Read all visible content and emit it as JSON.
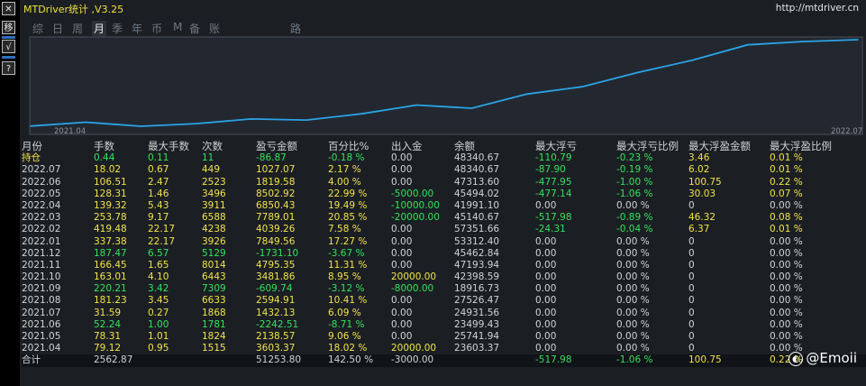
{
  "window": {
    "title": "MTDriver统计 ,V3.25",
    "url": "http://mtdriver.cn"
  },
  "left_tools": [
    "✕",
    "移",
    "√",
    "?"
  ],
  "period_tabs": [
    {
      "label": "综",
      "active": false
    },
    {
      "label": "日",
      "active": false
    },
    {
      "label": "周",
      "active": false
    },
    {
      "label": "月",
      "active": true
    },
    {
      "label": "季",
      "active": false
    },
    {
      "label": "年",
      "active": false
    },
    {
      "label": "币",
      "active": false
    },
    {
      "label": "M",
      "active": false
    },
    {
      "label": "备",
      "active": false
    },
    {
      "label": "账户",
      "active": false
    },
    {
      "label": "路径",
      "active": false
    }
  ],
  "chart_data": {
    "type": "line",
    "x_start_label": "2021.04",
    "x_end_label": "2022.07",
    "series": [
      {
        "color": "#2ba3e6",
        "x": [
          "2021.04",
          "2021.05",
          "2021.06",
          "2021.07",
          "2021.08",
          "2021.09",
          "2021.10",
          "2021.11",
          "2021.12",
          "2022.01",
          "2022.02",
          "2022.03",
          "2022.04",
          "2022.05",
          "2022.06",
          "2022.07"
        ],
        "values": [
          23603.37,
          25741.94,
          23499.43,
          24931.56,
          27526.47,
          26916.73,
          30398.59,
          35193.94,
          33462.84,
          41312.4,
          45351.66,
          53140.67,
          59991.1,
          68494.02,
          70313.6,
          71340.67
        ]
      }
    ]
  },
  "table": {
    "headers": [
      "月份",
      "手数",
      "最大手数",
      "次数",
      "盈亏金额",
      "百分比%",
      "出入金",
      "余额",
      "最大浮亏",
      "最大浮亏比例",
      "最大浮盈金额",
      "最大浮盈比例"
    ],
    "rows": [
      {
        "cells": [
          "持仓",
          "0.44",
          "0.11",
          "11",
          "-86.87",
          "-0.18 %",
          "0.00",
          "48340.67",
          "-110.79",
          "-0.23 %",
          "3.46",
          "0.01 %"
        ],
        "colors": [
          "y",
          "g",
          "g",
          "g",
          "g",
          "g",
          "w",
          "w",
          "g",
          "g",
          "y",
          "y"
        ]
      },
      {
        "cells": [
          "2022.07",
          "18.02",
          "0.67",
          "449",
          "1027.07",
          "2.17 %",
          "0.00",
          "48340.67",
          "-87.90",
          "-0.19 %",
          "6.02",
          "0.01 %"
        ],
        "colors": [
          "w",
          "y",
          "y",
          "y",
          "y",
          "y",
          "w",
          "w",
          "g",
          "g",
          "y",
          "y"
        ]
      },
      {
        "cells": [
          "2022.06",
          "106.51",
          "2.47",
          "2523",
          "1819.58",
          "4.00 %",
          "0.00",
          "47313.60",
          "-477.95",
          "-1.00 %",
          "100.75",
          "0.22 %"
        ],
        "colors": [
          "w",
          "y",
          "y",
          "y",
          "y",
          "y",
          "w",
          "w",
          "g",
          "g",
          "y",
          "y"
        ]
      },
      {
        "cells": [
          "2022.05",
          "128.31",
          "1.46",
          "3496",
          "8502.92",
          "22.99 %",
          "-5000.00",
          "45494.02",
          "-477.14",
          "-1.06 %",
          "30.03",
          "0.07 %"
        ],
        "colors": [
          "w",
          "y",
          "y",
          "y",
          "y",
          "y",
          "g",
          "w",
          "g",
          "g",
          "y",
          "y"
        ]
      },
      {
        "cells": [
          "2022.04",
          "139.32",
          "5.43",
          "3911",
          "6850.43",
          "19.49 %",
          "-10000.00",
          "41991.10",
          "0.00",
          "0.00 %",
          "0",
          "0.00 %"
        ],
        "colors": [
          "w",
          "y",
          "y",
          "y",
          "y",
          "y",
          "g",
          "w",
          "w",
          "w",
          "w",
          "w"
        ]
      },
      {
        "cells": [
          "2022.03",
          "253.78",
          "9.17",
          "6588",
          "7789.01",
          "20.85 %",
          "-20000.00",
          "45140.67",
          "-517.98",
          "-0.89 %",
          "46.32",
          "0.08 %"
        ],
        "colors": [
          "w",
          "y",
          "y",
          "y",
          "y",
          "y",
          "g",
          "w",
          "g",
          "g",
          "y",
          "y"
        ]
      },
      {
        "cells": [
          "2022.02",
          "419.48",
          "22.17",
          "4238",
          "4039.26",
          "7.58 %",
          "0.00",
          "57351.66",
          "-24.31",
          "-0.04 %",
          "6.37",
          "0.01 %"
        ],
        "colors": [
          "w",
          "y",
          "y",
          "y",
          "y",
          "y",
          "w",
          "w",
          "g",
          "g",
          "y",
          "y"
        ]
      },
      {
        "cells": [
          "2022.01",
          "337.38",
          "22.17",
          "3926",
          "7849.56",
          "17.27 %",
          "0.00",
          "53312.40",
          "0.00",
          "0.00 %",
          "0",
          "0.00 %"
        ],
        "colors": [
          "w",
          "y",
          "y",
          "y",
          "y",
          "y",
          "w",
          "w",
          "w",
          "w",
          "w",
          "w"
        ]
      },
      {
        "cells": [
          "2021.12",
          "187.47",
          "6.57",
          "5129",
          "-1731.10",
          "-3.67 %",
          "0.00",
          "45462.84",
          "0.00",
          "0.00 %",
          "0",
          "0.00 %"
        ],
        "colors": [
          "w",
          "g",
          "g",
          "g",
          "g",
          "g",
          "w",
          "w",
          "w",
          "w",
          "w",
          "w"
        ]
      },
      {
        "cells": [
          "2021.11",
          "166.45",
          "1.65",
          "8014",
          "4795.35",
          "11.31 %",
          "0.00",
          "47193.94",
          "0.00",
          "0.00 %",
          "0",
          "0.00 %"
        ],
        "colors": [
          "w",
          "y",
          "y",
          "y",
          "y",
          "y",
          "w",
          "w",
          "w",
          "w",
          "w",
          "w"
        ]
      },
      {
        "cells": [
          "2021.10",
          "163.01",
          "4.10",
          "6443",
          "3481.86",
          "8.95 %",
          "20000.00",
          "42398.59",
          "0.00",
          "0.00 %",
          "0",
          "0.00 %"
        ],
        "colors": [
          "w",
          "y",
          "y",
          "y",
          "y",
          "y",
          "y",
          "w",
          "w",
          "w",
          "w",
          "w"
        ]
      },
      {
        "cells": [
          "2021.09",
          "220.21",
          "3.42",
          "7309",
          "-609.74",
          "-3.12 %",
          "-8000.00",
          "18916.73",
          "0.00",
          "0.00 %",
          "0",
          "0.00 %"
        ],
        "colors": [
          "w",
          "g",
          "g",
          "g",
          "g",
          "g",
          "g",
          "w",
          "w",
          "w",
          "w",
          "w"
        ]
      },
      {
        "cells": [
          "2021.08",
          "181.23",
          "3.45",
          "6633",
          "2594.91",
          "10.41 %",
          "0.00",
          "27526.47",
          "0.00",
          "0.00 %",
          "0",
          "0.00 %"
        ],
        "colors": [
          "w",
          "y",
          "y",
          "y",
          "y",
          "y",
          "w",
          "w",
          "w",
          "w",
          "w",
          "w"
        ]
      },
      {
        "cells": [
          "2021.07",
          "31.59",
          "0.27",
          "1868",
          "1432.13",
          "6.09 %",
          "0.00",
          "24931.56",
          "0.00",
          "0.00 %",
          "0",
          "0.00 %"
        ],
        "colors": [
          "w",
          "y",
          "y",
          "y",
          "y",
          "y",
          "w",
          "w",
          "w",
          "w",
          "w",
          "w"
        ]
      },
      {
        "cells": [
          "2021.06",
          "52.24",
          "1.00",
          "1781",
          "-2242.51",
          "-8.71 %",
          "0.00",
          "23499.43",
          "0.00",
          "0.00 %",
          "0",
          "0.00 %"
        ],
        "colors": [
          "w",
          "g",
          "g",
          "g",
          "g",
          "g",
          "w",
          "w",
          "w",
          "w",
          "w",
          "w"
        ]
      },
      {
        "cells": [
          "2021.05",
          "78.31",
          "1.01",
          "1824",
          "2138.57",
          "9.06 %",
          "0.00",
          "25741.94",
          "0.00",
          "0.00 %",
          "0",
          "0.00 %"
        ],
        "colors": [
          "w",
          "y",
          "y",
          "y",
          "y",
          "y",
          "w",
          "w",
          "w",
          "w",
          "w",
          "w"
        ]
      },
      {
        "cells": [
          "2021.04",
          "79.12",
          "0.95",
          "1515",
          "3603.37",
          "18.02 %",
          "20000.00",
          "23603.37",
          "0.00",
          "0.00 %",
          "0",
          "0.00 %"
        ],
        "colors": [
          "w",
          "y",
          "y",
          "y",
          "y",
          "y",
          "y",
          "w",
          "w",
          "w",
          "w",
          "w"
        ]
      }
    ],
    "total": {
      "cells": [
        "合计",
        "2562.87",
        "",
        "",
        "51253.80",
        "142.50 %",
        "-3000.00",
        "",
        "-517.98",
        "-1.06 %",
        "100.75",
        "0.22 %"
      ],
      "colors": [
        "w",
        "w",
        "w",
        "w",
        "w",
        "w",
        "w",
        "w",
        "g",
        "g",
        "y",
        "y"
      ]
    }
  },
  "watermark": {
    "logo": "◐",
    "text": "@Emoii"
  },
  "colors": {
    "yellow": "#f2e24a",
    "green": "#35e15a",
    "white": "#d2d2d2",
    "line": "#2ba3e6"
  }
}
